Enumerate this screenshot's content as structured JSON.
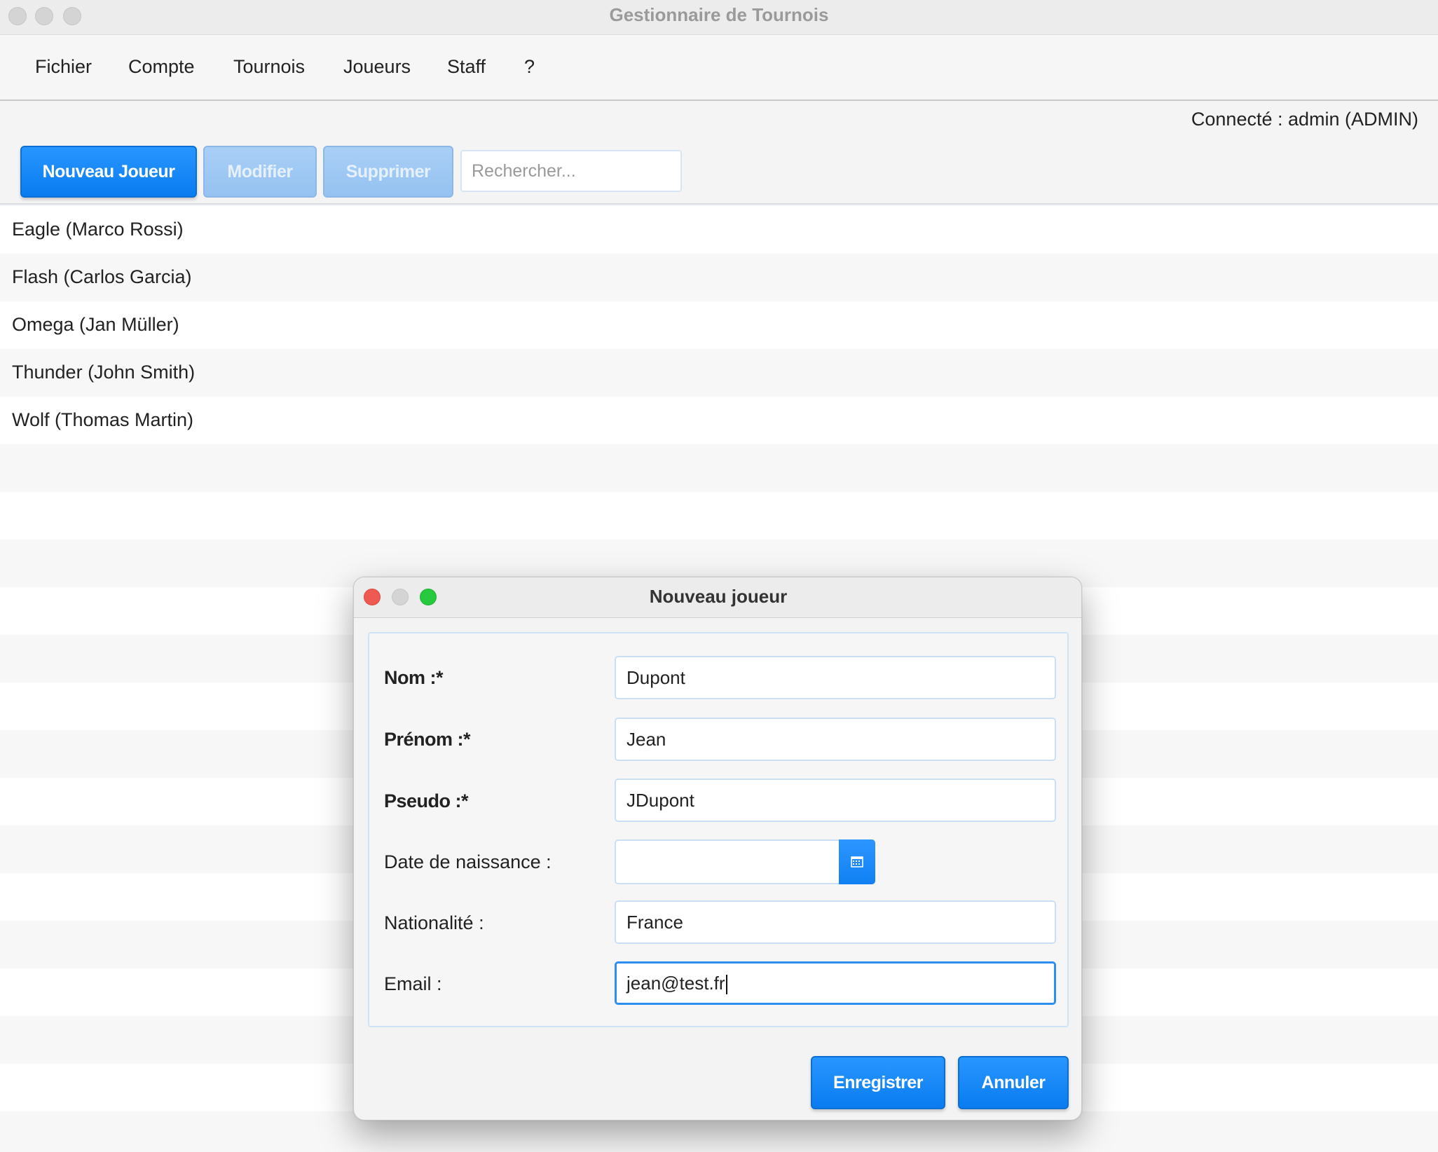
{
  "window": {
    "title": "Gestionnaire de Tournois"
  },
  "menu": [
    "Fichier",
    "Compte",
    "Tournois",
    "Joueurs",
    "Staff",
    "?"
  ],
  "status": "Connecté : admin (ADMIN)",
  "toolbar": {
    "new_label": "Nouveau Joueur",
    "edit_label": "Modifier",
    "delete_label": "Supprimer",
    "search_placeholder": "Rechercher..."
  },
  "players": [
    "Eagle (Marco Rossi)",
    "Flash (Carlos Garcia)",
    "Omega (Jan Müller)",
    "Thunder (John Smith)",
    "Wolf (Thomas Martin)"
  ],
  "dialog": {
    "title": "Nouveau joueur",
    "fields": {
      "nom": {
        "label": "Nom :*",
        "value": "Dupont"
      },
      "prenom": {
        "label": "Prénom :*",
        "value": "Jean"
      },
      "pseudo": {
        "label": "Pseudo :*",
        "value": "JDupont"
      },
      "date": {
        "label": "Date de naissance :",
        "value": ""
      },
      "nationalite": {
        "label": "Nationalité :",
        "value": "France"
      },
      "email": {
        "label": "Email :",
        "value": "jean@test.fr"
      }
    },
    "save_label": "Enregistrer",
    "cancel_label": "Annuler"
  },
  "colors": {
    "accent": "#0a7cf0",
    "close": "#ee5a52",
    "minimize": "#d6d6d6",
    "zoom": "#27c93f"
  }
}
